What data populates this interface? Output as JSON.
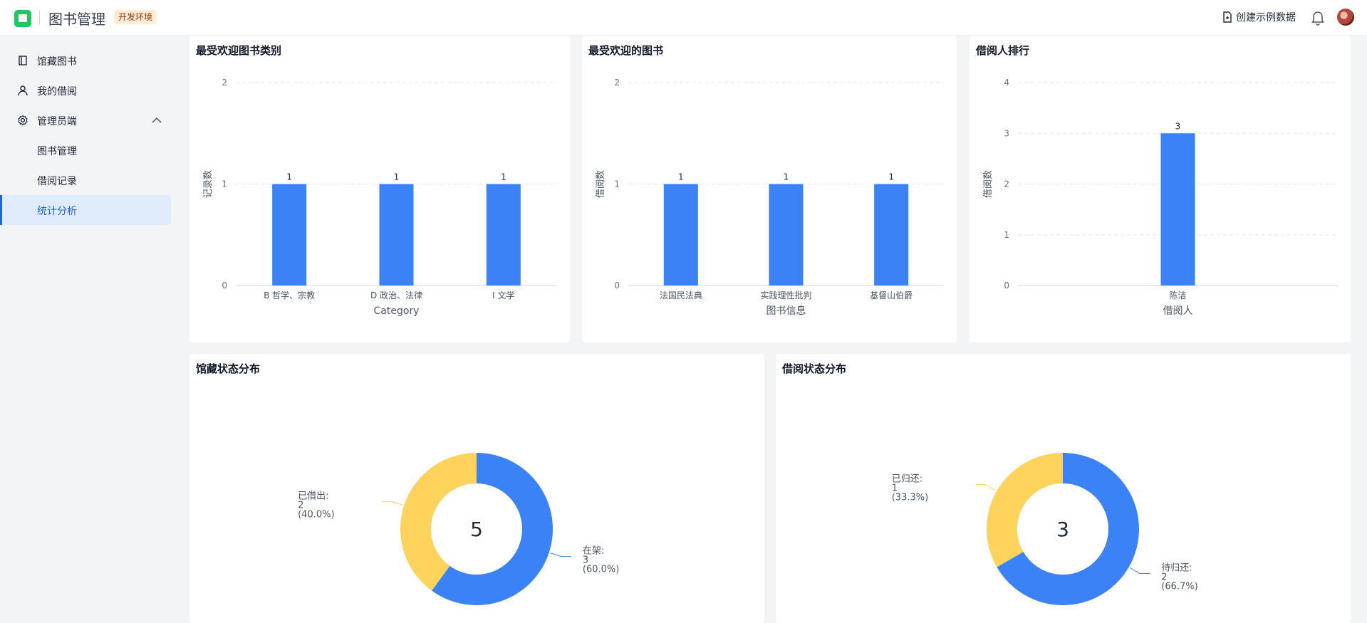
{
  "app": {
    "title": "图书管理",
    "env_badge": "开发环境",
    "seed_button_label": "创建示例数据",
    "icons": {
      "logo": "book-logo-icon",
      "seed": "file-plus-icon",
      "bell": "bell-icon",
      "avatar": "avatar"
    }
  },
  "sidebar": {
    "items": [
      {
        "label": "馆藏图书",
        "icon": "book-icon"
      },
      {
        "label": "我的借阅",
        "icon": "user-icon"
      },
      {
        "label": "管理员端",
        "icon": "gear-icon",
        "expanded": true
      },
      {
        "label": "图书管理"
      },
      {
        "label": "借阅记录"
      },
      {
        "label": "统计分析",
        "active": true
      }
    ]
  },
  "colors": {
    "primary": "#3b82f6",
    "secondary": "#fdd35c",
    "active_nav": "#1d64d8"
  },
  "cards": {
    "popular_categories": {
      "title": "最受欢迎图书类别"
    },
    "popular_books": {
      "title": "最受欢迎的图书"
    },
    "borrower_ranking": {
      "title": "借阅人排行"
    },
    "collection_status": {
      "title": "馆藏状态分布"
    },
    "borrow_status": {
      "title": "借阅状态分布"
    }
  },
  "chart_data": [
    {
      "id": "popular_categories",
      "type": "bar",
      "categories": [
        "B 哲学、宗教",
        "D 政治、法律",
        "I 文学"
      ],
      "values": [
        1,
        1,
        1
      ],
      "xlabel": "Category",
      "ylabel": "记录数",
      "ylim": [
        0,
        2
      ],
      "yticks": [
        0,
        1,
        2
      ],
      "grid": true
    },
    {
      "id": "popular_books",
      "type": "bar",
      "categories": [
        "法国民法典",
        "实践理性批判",
        "基督山伯爵"
      ],
      "values": [
        1,
        1,
        1
      ],
      "xlabel": "图书信息",
      "ylabel": "借阅数",
      "ylim": [
        0,
        2
      ],
      "yticks": [
        0,
        1,
        2
      ],
      "grid": true
    },
    {
      "id": "borrower_ranking",
      "type": "bar",
      "categories": [
        "陈洁"
      ],
      "values": [
        3
      ],
      "xlabel": "借阅人",
      "ylabel": "借阅数",
      "ylim": [
        0,
        4
      ],
      "yticks": [
        0,
        1,
        2,
        3,
        4
      ],
      "grid": true
    },
    {
      "id": "collection_status",
      "type": "pie",
      "center_total": "5",
      "slices": [
        {
          "name": "在架",
          "value": 3,
          "label_lines": [
            "在架:",
            "3",
            "(60.0%)"
          ]
        },
        {
          "name": "已借出",
          "value": 2,
          "label_lines": [
            "已借出:",
            "2",
            "(40.0%)"
          ]
        }
      ]
    },
    {
      "id": "borrow_status",
      "type": "pie",
      "center_total": "3",
      "slices": [
        {
          "name": "待归还",
          "value": 2,
          "label_lines": [
            "待归还:",
            "2",
            "(66.7%)"
          ]
        },
        {
          "name": "已归还",
          "value": 1,
          "label_lines": [
            "已归还:",
            "1",
            "(33.3%)"
          ]
        }
      ]
    }
  ]
}
